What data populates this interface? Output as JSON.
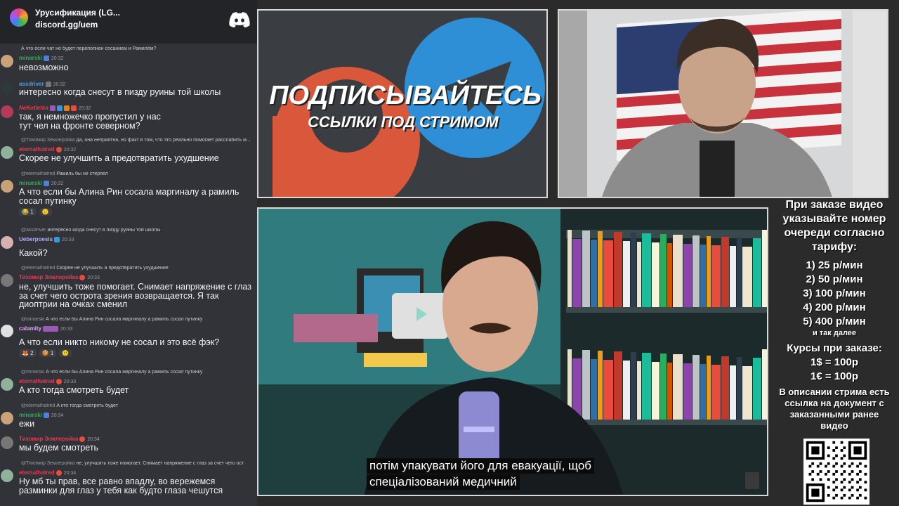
{
  "discord": {
    "server_name": "Урусификация (LG...",
    "invite": "discord.gg/uem",
    "logo_icon": "discord-logo-icon",
    "messages": [
      {
        "reply": "А что если чат не будет переполнен сосанием и Рамилём?",
        "author": "minarski",
        "author_color": "#3ba55d",
        "time": "20:32",
        "text": "невозможно"
      },
      {
        "author": "assdriver",
        "author_color": "#4f9bde",
        "time": "20:32",
        "text": "интересно когда снесут в пизду руины той школы"
      },
      {
        "author": "NeKotletka",
        "author_color": "#e8384f",
        "time": "20:32",
        "text": "так, я немножечко пропустил у нас тут чел на фронте северном?"
      },
      {
        "reply_author": "@Тихомир Землеройка",
        "reply": "да, она неприятна, но факт в том, что это реально помогает расслабить м...",
        "author": "eternalhatred",
        "author_color": "#e8384f",
        "time": "20:32",
        "text": "Скорее не улучшить а предотвратить ухудшение"
      },
      {
        "reply_author": "@eternalhatred",
        "reply": "Рамиль бы не стерпел",
        "author": "minarski",
        "author_color": "#3ba55d",
        "time": "20:32",
        "text": "А что если бы Алина Рин сосала маргиналу а рамиль сосал путинку",
        "reactions": [
          "😂 1",
          "🙂"
        ]
      },
      {
        "reply_author": "@assdriver",
        "reply": "интересно когда снесут в пизду руины той школы",
        "author": "Ueberpoesis",
        "author_color": "#a9b1ff",
        "time": "20:33",
        "text": "Какой?"
      },
      {
        "reply_author": "@eternalhatred",
        "reply": "Скорее не улучшить а предотвратить ухудшение",
        "author": "Тихомир Землеройка",
        "author_color": "#e8384f",
        "time": "20:33",
        "text": "не, улучшить тоже помогает. Снимает напряжение с глаз за счет чего острота зрения возвращается. Я так диоптрии на очках сменил"
      },
      {
        "reply_author": "@minarski",
        "reply": "А что если бы Алина Рин сосала маргиналу а рамиль сосал путинку",
        "author": "calamity",
        "author_color": "#e3a4ff",
        "time": "20:33",
        "text": "А что если никто никому не сосал и это всё фэк?",
        "reactions": [
          "🦊 2",
          "🍪 1",
          "🙂"
        ]
      },
      {
        "reply_author": "@minarski",
        "reply": "А что если бы Алина Рин сосала маргиналу а рамиль сосал путинку",
        "author": "eternalhatred",
        "author_color": "#e8384f",
        "time": "20:33",
        "text": "А кто тогда смотреть будет"
      },
      {
        "reply_author": "@eternalhatred",
        "reply": "А кто тогда смотреть будет",
        "author": "minarski",
        "author_color": "#3ba55d",
        "time": "20:34",
        "text": "ежи"
      },
      {
        "author": "Тихомир Землеройка",
        "author_color": "#e8384f",
        "time": "20:34",
        "text": "мы будем смотреть"
      },
      {
        "reply_author": "@Тихомир Землеройка",
        "reply": "не, улучшить тоже помогает. Снимает напряжение с глаз за счет чего ост",
        "author": "eternalhatred",
        "author_color": "#e8384f",
        "time": "20:34",
        "text": "Ну мб ты прав, все равно впадлу, во вережемся разминки для глаз у тебя как будто глаза чешутся"
      }
    ]
  },
  "promo": {
    "title": "ПОДПИСЫВАЙТЕСЬ",
    "subtitle": "ССЫЛКИ ПОД СТРИМОМ"
  },
  "subtitles": {
    "line1": "потім упакувати його для евакуації, щоб",
    "line2": "спеціалізований медичний"
  },
  "info": {
    "heading": "При заказе видео указывайте номер очереди согласно тарифу:",
    "tariffs": [
      "1) 25 р/мин",
      "2) 50 р/мин",
      "3) 100 р/мин",
      "4) 200 р/мин",
      "5) 400 р/мин"
    ],
    "etc": "и так далее",
    "courses_title": "Курсы при заказе:",
    "courses": [
      "1$ = 100р",
      "1€ = 100р"
    ],
    "description": "В описании стрима есть ссылка на документ с заказанными ранее видео"
  }
}
